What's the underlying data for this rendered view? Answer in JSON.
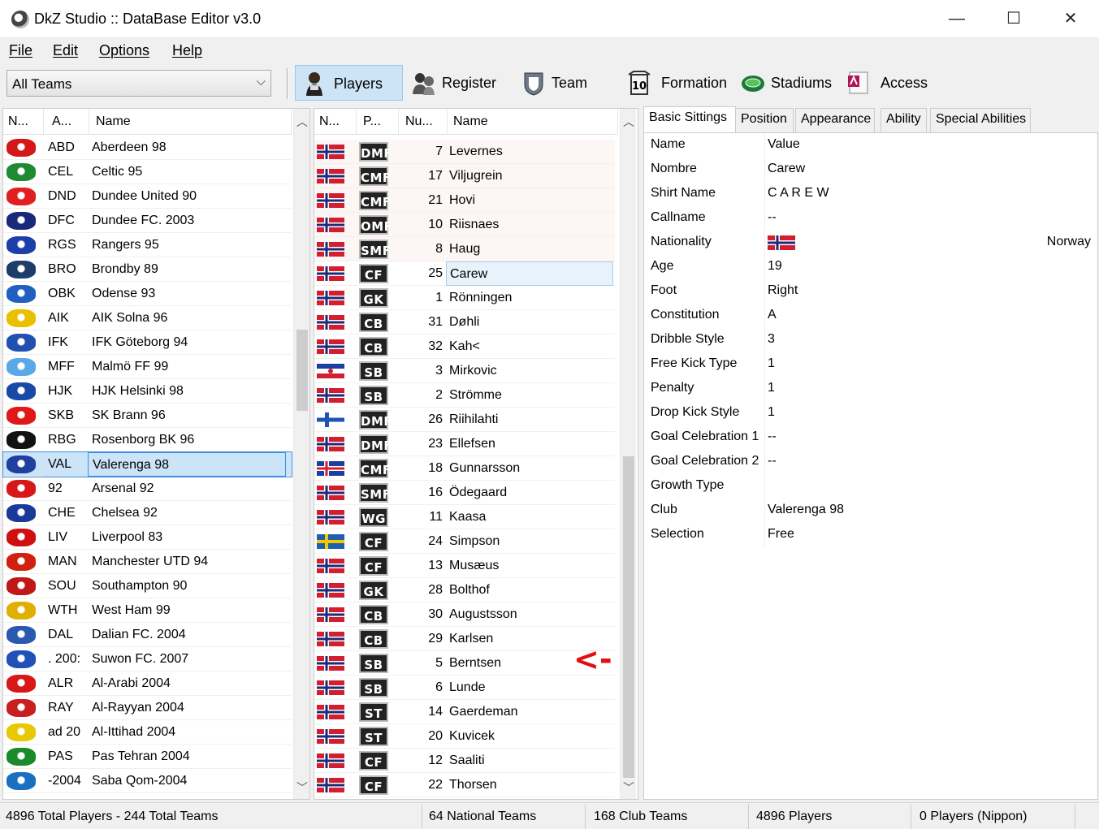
{
  "window": {
    "title": "DkZ Studio :: DataBase Editor v3.0",
    "min": "—",
    "max": "☐",
    "close": "✕"
  },
  "menu": [
    "File",
    "Edit",
    "Options",
    "Help"
  ],
  "toolbar": {
    "team_filter": "All Teams",
    "buttons": [
      {
        "label": "Players",
        "icon": "player-icon",
        "active": true
      },
      {
        "label": "Register",
        "icon": "register-icon"
      },
      {
        "label": "Team",
        "icon": "team-icon"
      },
      {
        "label": "Formation",
        "icon": "formation-icon"
      },
      {
        "label": "Stadiums",
        "icon": "stadium-icon"
      },
      {
        "label": "Access",
        "icon": "access-icon"
      }
    ]
  },
  "teams": {
    "columns": [
      "N...",
      "A...",
      "Name"
    ],
    "selected_index": 13,
    "rows": [
      {
        "abbr": "ABD",
        "name": "Aberdeen 98",
        "color": "#d21818"
      },
      {
        "abbr": "CEL",
        "name": "Celtic 95",
        "color": "#1e8a32"
      },
      {
        "abbr": "DND",
        "name": "Dundee United 90",
        "color": "#e02020"
      },
      {
        "abbr": "DFC",
        "name": "Dundee FC. 2003",
        "color": "#1a2a7a"
      },
      {
        "abbr": "RGS",
        "name": "Rangers 95",
        "color": "#1f3fa8"
      },
      {
        "abbr": "BRO",
        "name": "Brondby 89",
        "color": "#1c3c6a"
      },
      {
        "abbr": "OBK",
        "name": "Odense 93",
        "color": "#2060c0"
      },
      {
        "abbr": "AIK",
        "name": "AIK Solna 96",
        "color": "#e8c000"
      },
      {
        "abbr": "IFK",
        "name": "IFK Göteborg 94",
        "color": "#2050b0"
      },
      {
        "abbr": "MFF",
        "name": "Malmö FF 99",
        "color": "#5aa8e8"
      },
      {
        "abbr": "HJK",
        "name": "HJK Helsinki 98",
        "color": "#1848a8"
      },
      {
        "abbr": "SKB",
        "name": "SK Brann 96",
        "color": "#e01818"
      },
      {
        "abbr": "RBG",
        "name": "Rosenborg BK 96",
        "color": "#111111"
      },
      {
        "abbr": "VAL",
        "name": "Valerenga 98",
        "color": "#2040a0"
      },
      {
        "abbr": "92",
        "name": "Arsenal 92",
        "color": "#d81818"
      },
      {
        "abbr": "CHE",
        "name": "Chelsea 92",
        "color": "#1a3a9a"
      },
      {
        "abbr": "LIV",
        "name": "Liverpool 83",
        "color": "#d01010"
      },
      {
        "abbr": "MAN",
        "name": "Manchester UTD 94",
        "color": "#d02010"
      },
      {
        "abbr": "SOU",
        "name": "Southampton 90",
        "color": "#c01818"
      },
      {
        "abbr": "WTH",
        "name": "West Ham 99",
        "color": "#e0b000"
      },
      {
        "abbr": "DAL",
        "name": "Dalian FC. 2004",
        "color": "#2a5ab0"
      },
      {
        "abbr": ". 200:",
        "name": "Suwon FC. 2007",
        "color": "#2050b8"
      },
      {
        "abbr": "ALR",
        "name": "Al-Arabi 2004",
        "color": "#d81818"
      },
      {
        "abbr": "RAY",
        "name": "Al-Rayyan 2004",
        "color": "#c82020"
      },
      {
        "abbr": "ad 20",
        "name": "Al-Ittihad 2004",
        "color": "#e8c800"
      },
      {
        "abbr": "PAS",
        "name": "Pas Tehran 2004",
        "color": "#1a8a2a"
      },
      {
        "abbr": "-2004",
        "name": "Saba Qom-2004",
        "color": "#1a70c0"
      }
    ]
  },
  "players": {
    "columns": [
      "N...",
      "P...",
      "Nu...",
      "Name"
    ],
    "selected_index": 5,
    "rows": [
      {
        "flag": "NOR",
        "pos": "DMF",
        "num": "7",
        "name": "Levernes"
      },
      {
        "flag": "NOR",
        "pos": "CMF",
        "num": "17",
        "name": "Viljugrein"
      },
      {
        "flag": "NOR",
        "pos": "CMF",
        "num": "21",
        "name": "Hovi"
      },
      {
        "flag": "NOR",
        "pos": "OMF",
        "num": "10",
        "name": "Riisnaes"
      },
      {
        "flag": "NOR",
        "pos": "SMF",
        "num": "8",
        "name": "Haug"
      },
      {
        "flag": "NOR",
        "pos": "CF",
        "num": "25",
        "name": "Carew"
      },
      {
        "flag": "NOR",
        "pos": "GK",
        "num": "1",
        "name": "Rönningen"
      },
      {
        "flag": "NOR",
        "pos": "CB",
        "num": "31",
        "name": "Døhli"
      },
      {
        "flag": "NOR",
        "pos": "CB",
        "num": "32",
        "name": "Kah<"
      },
      {
        "flag": "YUG",
        "pos": "SB",
        "num": "3",
        "name": "Mirkovic"
      },
      {
        "flag": "NOR",
        "pos": "SB",
        "num": "2",
        "name": "Strömme"
      },
      {
        "flag": "FIN",
        "pos": "DMF",
        "num": "26",
        "name": "Riihilahti"
      },
      {
        "flag": "NOR",
        "pos": "DMF",
        "num": "23",
        "name": "Ellefsen"
      },
      {
        "flag": "ISL",
        "pos": "CMF",
        "num": "18",
        "name": "Gunnarsson"
      },
      {
        "flag": "NOR",
        "pos": "SMF",
        "num": "16",
        "name": "Ödegaard"
      },
      {
        "flag": "NOR",
        "pos": "WG",
        "num": "11",
        "name": "Kaasa"
      },
      {
        "flag": "SWE",
        "pos": "CF",
        "num": "24",
        "name": "Simpson"
      },
      {
        "flag": "NOR",
        "pos": "CF",
        "num": "13",
        "name": "Musæus"
      },
      {
        "flag": "NOR",
        "pos": "GK",
        "num": "28",
        "name": "Bolthof"
      },
      {
        "flag": "NOR",
        "pos": "CB",
        "num": "30",
        "name": "Augustsson"
      },
      {
        "flag": "NOR",
        "pos": "CB",
        "num": "29",
        "name": "Karlsen"
      },
      {
        "flag": "NOR",
        "pos": "SB",
        "num": "5",
        "name": "Berntsen"
      },
      {
        "flag": "NOR",
        "pos": "SB",
        "num": "6",
        "name": "Lunde"
      },
      {
        "flag": "NOR",
        "pos": "ST",
        "num": "14",
        "name": "Gaerdeman"
      },
      {
        "flag": "NOR",
        "pos": "ST",
        "num": "20",
        "name": "Kuvicek"
      },
      {
        "flag": "NOR",
        "pos": "CF",
        "num": "12",
        "name": "Saaliti"
      },
      {
        "flag": "NOR",
        "pos": "CF",
        "num": "22",
        "name": "Thorsen"
      }
    ]
  },
  "annotation": "<-",
  "tabs": [
    "Basic Sittings",
    "Position",
    "Appearance",
    "Ability",
    "Special Abilities"
  ],
  "props": {
    "header": {
      "key": "Name",
      "value": "Value"
    },
    "rows": [
      {
        "key": "Nombre",
        "value": "Carew"
      },
      {
        "key": "Shirt Name",
        "value": "C A R E W"
      },
      {
        "key": "Callname",
        "value": "--"
      },
      {
        "key": "Nationality",
        "value": "Norway",
        "flag": "NOR"
      },
      {
        "key": "Age",
        "value": "19"
      },
      {
        "key": "Foot",
        "value": "Right"
      },
      {
        "key": "Constitution",
        "value": "A"
      },
      {
        "key": "Dribble Style",
        "value": "3"
      },
      {
        "key": "Free Kick Type",
        "value": "1"
      },
      {
        "key": "Penalty",
        "value": "1"
      },
      {
        "key": "Drop Kick Style",
        "value": "1"
      },
      {
        "key": "Goal Celebration 1",
        "value": "--"
      },
      {
        "key": "Goal Celebration 2",
        "value": "--"
      },
      {
        "key": "Growth Type",
        "value": ""
      },
      {
        "key": "Club",
        "value": "Valerenga 98"
      },
      {
        "key": "Selection",
        "value": "Free"
      }
    ]
  },
  "status": [
    "4896 Total Players  -  244 Total Teams",
    "64 National Teams",
    "168 Club Teams",
    "4896 Players",
    "0 Players (Nippon)"
  ],
  "colors": {
    "selection": "#cce4f7",
    "selection_border": "#3d8ee0",
    "annotation": "#e01010"
  }
}
